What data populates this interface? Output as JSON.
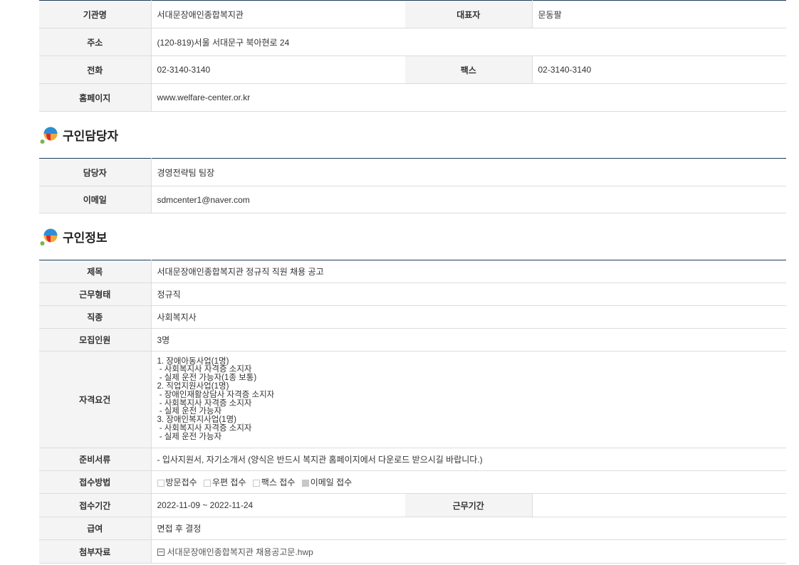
{
  "org": {
    "name_label": "기관명",
    "name": "서대문장애인종합복지관",
    "rep_label": "대표자",
    "rep": "문동팔",
    "address_label": "주소",
    "address": "(120-819)서울 서대문구 북아현로 24",
    "phone_label": "전화",
    "phone": "02-3140-3140",
    "fax_label": "팩스",
    "fax": "02-3140-3140",
    "homepage_label": "홈페이지",
    "homepage": "www.welfare-center.or.kr"
  },
  "contact_section": {
    "title": "구인담당자",
    "manager_label": "담당자",
    "manager": "경영전략팀 팀장",
    "email_label": "이메일",
    "email": "sdmcenter1@naver.com"
  },
  "job_section": {
    "title": "구인정보",
    "subject_label": "제목",
    "subject": "서대문장애인종합복지관 정규직 직원 채용 공고",
    "worktype_label": "근무형태",
    "worktype": "정규직",
    "jobtype_label": "직종",
    "jobtype": "사회복지사",
    "headcount_label": "모집인원",
    "headcount": "3명",
    "requirements_label": "자격요건",
    "requirements": [
      "1. 장애아동사업(1명)",
      " - 사회복지사 자격증 소지자",
      " - 실제 운전 가능자(1종 보통)",
      "2. 직업지원사업(1명)",
      " - 장애인재활상담사 자격증 소지자",
      " - 사회복지사 자격증 소지자",
      " - 실제 운전 가능자",
      "3. 장애인복지사업(1명)",
      " - 사회복지사 자격증 소지자",
      " - 실제 운전 가능자"
    ],
    "documents_label": "준비서류",
    "documents": "- 입사지원서, 자기소개서 (양식은 반드시 복지관 홈페이지에서 다운로드 받으시길 바랍니다.)",
    "method_label": "접수방법",
    "methods": [
      {
        "label": "방문접수",
        "checked": false
      },
      {
        "label": "우편 접수",
        "checked": false
      },
      {
        "label": "팩스 접수",
        "checked": false
      },
      {
        "label": "이메일 접수",
        "checked": true
      }
    ],
    "period_label": "접수기간",
    "period": "2022-11-09 ~ 2022-11-24",
    "work_period_label": "근무기간",
    "work_period": "",
    "salary_label": "급여",
    "salary": "면접 후 결정",
    "attachment_label": "첨부자료",
    "attachment": "서대문장애인종합복지관 채용공고문.hwp"
  }
}
